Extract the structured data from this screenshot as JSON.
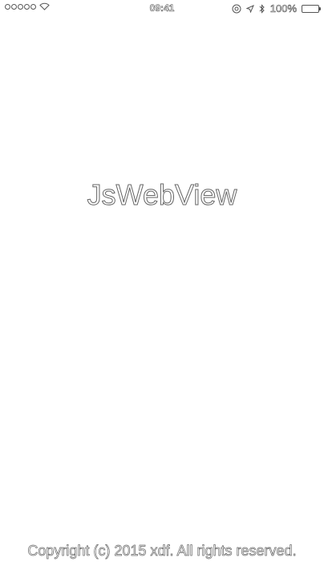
{
  "status_bar": {
    "time": "09:41",
    "battery_percent": "100%",
    "icons": [
      "signal-dots-icon",
      "wifi-icon",
      "at-icon",
      "location-arrow-icon",
      "bluetooth-icon",
      "battery-icon"
    ],
    "battery_level": 1.0
  },
  "splash": {
    "title": "JsWebView",
    "copyright": "Copyright (c) 2015 xdf. All rights reserved."
  },
  "colors": {
    "background": "#ffffff",
    "outline": "#666666"
  }
}
